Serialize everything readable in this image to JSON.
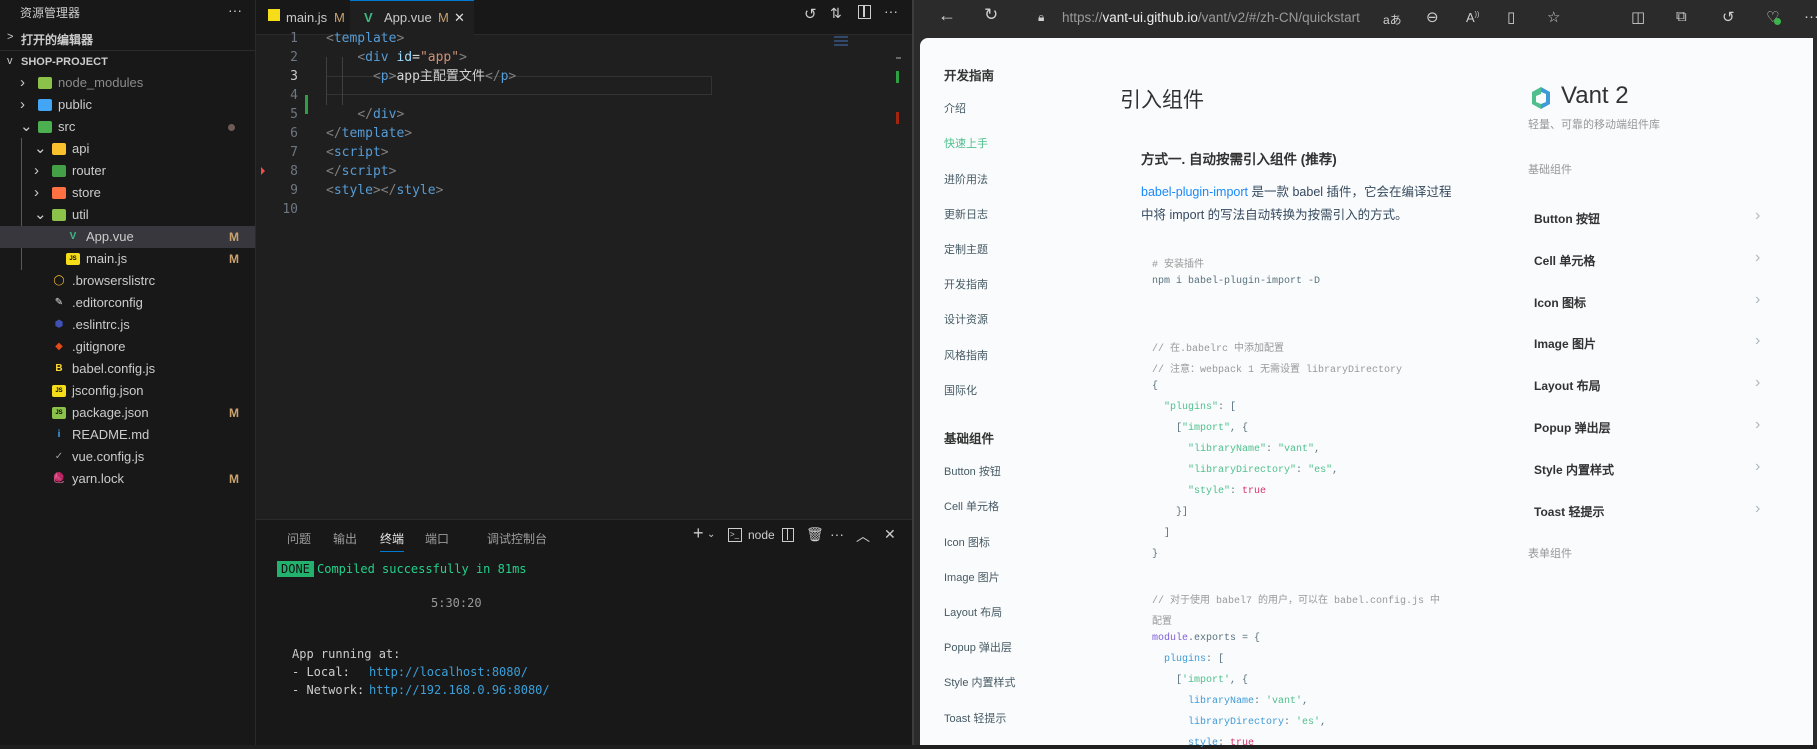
{
  "explorer": {
    "title": "资源管理器",
    "more": "···",
    "open_editors": "打开的编辑器",
    "project": "SHOP-PROJECT",
    "items": [
      {
        "name": "node_modules",
        "depth": 0,
        "chevron": ">",
        "icon": "#8bc34a",
        "dim": true
      },
      {
        "name": "public",
        "depth": 0,
        "chevron": ">",
        "icon": "#42a5f5"
      },
      {
        "name": "src",
        "depth": 0,
        "chevron": "v",
        "icon": "#4caf50",
        "dot": true
      },
      {
        "name": "api",
        "depth": 1,
        "chevron": "v",
        "icon": "#fbc02d"
      },
      {
        "name": "router",
        "depth": 1,
        "chevron": ">",
        "icon": "#43a047"
      },
      {
        "name": "store",
        "depth": 1,
        "chevron": ">",
        "icon": "#ff7043"
      },
      {
        "name": "util",
        "depth": 1,
        "chevron": "v",
        "icon": "#8bc34a"
      },
      {
        "name": "App.vue",
        "depth": 2,
        "icon": "#41b883",
        "badge": "M",
        "selected": true,
        "glyph": "V"
      },
      {
        "name": "main.js",
        "depth": 2,
        "icon": "#f5de19",
        "badge": "M",
        "glyph": "JS"
      },
      {
        "name": ".browserslistrc",
        "depth": 1,
        "icon": "#fbc02d",
        "glyph": "◯"
      },
      {
        "name": ".editorconfig",
        "depth": 1,
        "icon": "#e0e0e0",
        "glyph": "✎"
      },
      {
        "name": ".eslintrc.js",
        "depth": 1,
        "icon": "#3f51b5",
        "glyph": "⬢"
      },
      {
        "name": ".gitignore",
        "depth": 1,
        "icon": "#e64a19",
        "glyph": "◆"
      },
      {
        "name": "babel.config.js",
        "depth": 1,
        "icon": "#fdd835",
        "glyph": "B"
      },
      {
        "name": "jsconfig.json",
        "depth": 1,
        "icon": "#f5de19",
        "glyph": "JS"
      },
      {
        "name": "package.json",
        "depth": 1,
        "icon": "#8bc34a",
        "badge": "M",
        "glyph": "JS"
      },
      {
        "name": "README.md",
        "depth": 1,
        "icon": "#42a5f5",
        "glyph": "i"
      },
      {
        "name": "vue.config.js",
        "depth": 1,
        "icon": "#9e9e9e",
        "glyph": "✓"
      },
      {
        "name": "yarn.lock",
        "depth": 1,
        "icon": "#2c8ebb",
        "badge": "M",
        "glyph": "🧶"
      }
    ]
  },
  "editor": {
    "tabs": [
      {
        "label": "main.js",
        "badge": "M",
        "icon": "JS"
      },
      {
        "label": "App.vue",
        "badge": "M",
        "icon": "V",
        "close": "✕",
        "active": true
      }
    ],
    "actions": [
      "history",
      "compare",
      "split",
      "more"
    ],
    "current_line": 3,
    "lines": [
      [
        [
          "tk-br",
          "<"
        ],
        [
          "tk-tag",
          "template"
        ],
        [
          "tk-br",
          ">"
        ]
      ],
      [
        [
          "tk-txt",
          "    "
        ],
        [
          "tk-br",
          "<"
        ],
        [
          "tk-tag",
          "div"
        ],
        [
          "tk-txt",
          " "
        ],
        [
          "tk-attr",
          "id"
        ],
        [
          "tk-txt",
          "="
        ],
        [
          "tk-str",
          "\"app\""
        ],
        [
          "tk-br",
          ">"
        ]
      ],
      [
        [
          "tk-txt",
          "      "
        ],
        [
          "tk-br",
          "<"
        ],
        [
          "tk-tag",
          "p"
        ],
        [
          "tk-br",
          ">"
        ],
        [
          "tk-txt",
          "app主配置文件"
        ],
        [
          "tk-br",
          "</"
        ],
        [
          "tk-tag",
          "p"
        ],
        [
          "tk-br",
          ">"
        ]
      ],
      [
        [
          "tk-txt",
          ""
        ]
      ],
      [
        [
          "tk-txt",
          "    "
        ],
        [
          "tk-br",
          "</"
        ],
        [
          "tk-tag",
          "div"
        ],
        [
          "tk-br",
          ">"
        ]
      ],
      [
        [
          "tk-br",
          "</"
        ],
        [
          "tk-tag",
          "template"
        ],
        [
          "tk-br",
          ">"
        ]
      ],
      [
        [
          "tk-br",
          "<"
        ],
        [
          "tk-tag",
          "script"
        ],
        [
          "tk-br",
          ">"
        ]
      ],
      [
        [
          "tk-br",
          "</"
        ],
        [
          "tk-tag",
          "script"
        ],
        [
          "tk-br",
          ">"
        ]
      ],
      [
        [
          "tk-br",
          "<"
        ],
        [
          "tk-tag",
          "style"
        ],
        [
          "tk-br",
          "></"
        ],
        [
          "tk-tag",
          "style"
        ],
        [
          "tk-br",
          ">"
        ]
      ],
      [
        [
          "tk-txt",
          ""
        ]
      ]
    ]
  },
  "panel": {
    "tabs": [
      "问题",
      "输出",
      "终端",
      "端口",
      "调试控制台"
    ],
    "active_tab": "终端",
    "shell": "node",
    "done": "DONE",
    "compiled": "Compiled successfully in 81ms",
    "time": "5:30:20",
    "running": "App running at:",
    "local_label": "- Local:   ",
    "local_url": "http://localhost:8080/",
    "network_label": "- Network: ",
    "network_url": "http://192.168.0.96:8080/"
  },
  "browser": {
    "url_prefix": "https://",
    "url_host": "vant-ui.github.io",
    "url_path": "/vant/v2/#/zh-CN/quickstart",
    "nav": [
      {
        "label": "开发指南",
        "type": "h"
      },
      {
        "label": "介绍"
      },
      {
        "label": "快速上手",
        "active": true
      },
      {
        "label": "进阶用法"
      },
      {
        "label": "更新日志"
      },
      {
        "label": "定制主题"
      },
      {
        "label": "开发指南"
      },
      {
        "label": "设计资源"
      },
      {
        "label": "风格指南"
      },
      {
        "label": "国际化"
      },
      {
        "label": "基础组件",
        "type": "h"
      },
      {
        "label": "Button 按钮"
      },
      {
        "label": "Cell 单元格"
      },
      {
        "label": "Icon 图标"
      },
      {
        "label": "Image 图片"
      },
      {
        "label": "Layout 布局"
      },
      {
        "label": "Popup 弹出层"
      },
      {
        "label": "Style 内置样式"
      },
      {
        "label": "Toast 轻提示"
      }
    ],
    "title": "引入组件",
    "section": "方式一. 自动按需引入组件 (推荐)",
    "para_link": "babel-plugin-import",
    "para_1": " 是一款 babel 插件，它会在编译过程",
    "para_2": "中将 import 的写法自动转换为按需引入的方式。",
    "code": [
      [
        [
          "c-com",
          "# 安装插件"
        ]
      ],
      [
        [
          "",
          "npm i babel-plugin-import -D"
        ]
      ],
      [],
      [],
      [
        [
          "c-com",
          "// 在.babelrc 中添加配置"
        ]
      ],
      [
        [
          "c-com",
          "// 注意：webpack 1 无需设置 libraryDirectory"
        ]
      ],
      [
        [
          "",
          "{"
        ]
      ],
      [
        [
          "",
          "  "
        ],
        [
          "c-str",
          "\"plugins\""
        ],
        [
          "",
          ": ["
        ]
      ],
      [
        [
          "",
          "    ["
        ],
        [
          "c-str",
          "\"import\""
        ],
        [
          "",
          ", {"
        ]
      ],
      [
        [
          "",
          "      "
        ],
        [
          "c-str",
          "\"libraryName\""
        ],
        [
          "",
          ": "
        ],
        [
          "c-str",
          "\"vant\""
        ],
        [
          "",
          ","
        ]
      ],
      [
        [
          "",
          "      "
        ],
        [
          "c-str",
          "\"libraryDirectory\""
        ],
        [
          "",
          ": "
        ],
        [
          "c-str",
          "\"es\""
        ],
        [
          "",
          ","
        ]
      ],
      [
        [
          "",
          "      "
        ],
        [
          "c-str",
          "\"style\""
        ],
        [
          "",
          ": "
        ],
        [
          "c-kw",
          "true"
        ]
      ],
      [
        [
          "",
          "    }]"
        ]
      ],
      [
        [
          "",
          "  ]"
        ]
      ],
      [
        [
          "",
          "}"
        ]
      ],
      [],
      [
        [
          "c-com",
          "// 对于使用 babel7 的用户，可以在 babel.config.js 中"
        ]
      ],
      [
        [
          "c-com",
          "配置"
        ]
      ],
      [
        [
          "c-obj",
          "module"
        ],
        [
          "",
          ".exports = {"
        ]
      ],
      [
        [
          "",
          "  "
        ],
        [
          "c-key",
          "plugins"
        ],
        [
          "",
          ": ["
        ]
      ],
      [
        [
          "",
          "    ["
        ],
        [
          "c-str",
          "'import'"
        ],
        [
          "",
          ", {"
        ]
      ],
      [
        [
          "",
          "      "
        ],
        [
          "c-key",
          "libraryName"
        ],
        [
          "",
          ": "
        ],
        [
          "c-str",
          "'vant'"
        ],
        [
          "",
          ","
        ]
      ],
      [
        [
          "",
          "      "
        ],
        [
          "c-key",
          "libraryDirectory"
        ],
        [
          "",
          ": "
        ],
        [
          "c-str",
          "'es'"
        ],
        [
          "",
          ","
        ]
      ],
      [
        [
          "",
          "      "
        ],
        [
          "c-key",
          "style"
        ],
        [
          "",
          ": "
        ],
        [
          "c-kw",
          "true"
        ]
      ]
    ],
    "brand": "Vant 2",
    "tagline": "轻量、可靠的移动端组件库",
    "mobile_group": "基础组件",
    "mobile_items": [
      "Button 按钮",
      "Cell 单元格",
      "Icon 图标",
      "Image 图片",
      "Layout 布局",
      "Popup 弹出层",
      "Style 内置样式",
      "Toast 轻提示"
    ],
    "mobile_group2": "表单组件",
    "accent": "#4fc08d"
  }
}
